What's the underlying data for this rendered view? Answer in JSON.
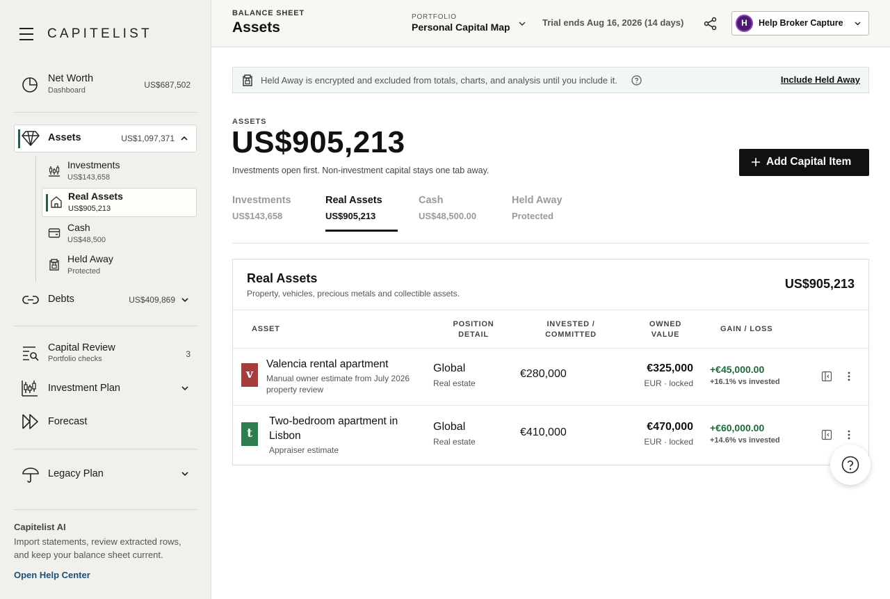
{
  "sidebar": {
    "logo": "CAPITELIST",
    "net_worth": {
      "title": "Net Worth",
      "sub": "Dashboard",
      "amount": "US$687,502"
    },
    "assets": {
      "title": "Assets",
      "amount": "US$1,097,371"
    },
    "sub_items": [
      {
        "title": "Investments",
        "amount": "US$143,658"
      },
      {
        "title": "Real Assets",
        "amount": "US$905,213"
      },
      {
        "title": "Cash",
        "amount": "US$48,500"
      },
      {
        "title": "Held Away",
        "amount": "Protected"
      }
    ],
    "debts": {
      "title": "Debts",
      "amount": "US$409,869"
    },
    "capital_review": {
      "title": "Capital Review",
      "sub": "Portfolio checks",
      "count": "3"
    },
    "investment_plan": {
      "title": "Investment Plan"
    },
    "forecast": {
      "title": "Forecast"
    },
    "legacy_plan": {
      "title": "Legacy Plan"
    },
    "ai": {
      "title": "Capitelist AI",
      "text": "Import statements, review extracted rows, and keep your balance sheet current.",
      "link": "Open Help Center"
    }
  },
  "header": {
    "crumb": "BALANCE SHEET",
    "title": "Assets",
    "portfolio_label": "PORTFOLIO",
    "portfolio_name": "Personal Capital Map",
    "trial": "Trial ends Aug 16, 2026 (14 days)",
    "user_initial": "H",
    "user_name": "Help Broker Capture"
  },
  "notice": {
    "text": "Held Away is encrypted and excluded from totals, charts, and analysis until you include it.",
    "link": "Include Held Away"
  },
  "summary": {
    "label": "ASSETS",
    "total": "US$905,213",
    "note": "Investments open first. Non-investment capital stays one tab away.",
    "add_button": "Add Capital Item"
  },
  "tabs": [
    {
      "title": "Investments",
      "value": "US$143,658"
    },
    {
      "title": "Real Assets",
      "value": "US$905,213"
    },
    {
      "title": "Cash",
      "value": "US$48,500.00"
    },
    {
      "title": "Held Away",
      "value": "Protected"
    }
  ],
  "card": {
    "title": "Real Assets",
    "subtitle": "Property, vehicles, precious metals and collectible assets.",
    "total": "US$905,213",
    "columns": [
      "ASSET",
      "POSITION DETAIL",
      "INVESTED / COMMITTED",
      "OWNED VALUE",
      "GAIN / LOSS"
    ],
    "rows": [
      {
        "badge": "v",
        "badge_color": "#a63d3d",
        "name": "Valencia rental apartment",
        "desc": "Manual owner estimate from July 2026 property review",
        "position": "Global",
        "position_sub": "Real estate",
        "invested": "€280,000",
        "owned": "€325,000",
        "owned_sub": "EUR · locked",
        "gain": "+€45,000.00",
        "gain_pct": "+16.1% vs invested"
      },
      {
        "badge": "t",
        "badge_color": "#2e7d4f",
        "name": "Two-bedroom apartment in Lisbon",
        "desc": "Appraiser estimate",
        "position": "Global",
        "position_sub": "Real estate",
        "invested": "€410,000",
        "owned": "€470,000",
        "owned_sub": "EUR · locked",
        "gain": "+€60,000.00",
        "gain_pct": "+14.6% vs invested"
      }
    ]
  },
  "colors": {
    "accent": "#2c5a4f",
    "gain": "#1b6a3a",
    "link": "#1b4f7a",
    "avatar": "#4b1a6b"
  }
}
